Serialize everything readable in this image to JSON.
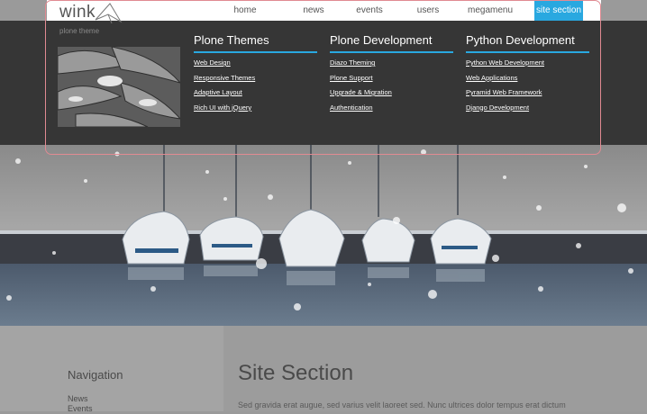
{
  "header": {
    "logo_text": "wink",
    "logo_subtitle": "plone theme",
    "nav": [
      {
        "label": "home"
      },
      {
        "label": "news"
      },
      {
        "label": "events"
      },
      {
        "label": "users"
      },
      {
        "label": "megamenu"
      },
      {
        "label": "site section",
        "active": true
      }
    ]
  },
  "megamenu": {
    "columns": [
      {
        "title": "Plone Themes",
        "links": [
          "Web Design",
          "Responsive Themes",
          "Adaptive Layout",
          "Rich UI with jQuery"
        ]
      },
      {
        "title": "Plone Development",
        "links": [
          "Diazo Theming",
          "Plone Support",
          "Upgrade & Migration",
          "Authentication"
        ]
      },
      {
        "title": "Python Development",
        "links": [
          "Python Web Development",
          "Web Applications",
          "Pyramid Web Framework",
          "Django Development"
        ]
      }
    ]
  },
  "sidebar": {
    "heading": "Navigation",
    "items": [
      "News",
      "Events"
    ]
  },
  "main": {
    "title": "Site Section",
    "body": "Sed gravida erat augue, sed varius velit laoreet sed. Nunc ultrices dolor tempus erat dictum"
  },
  "colors": {
    "accent": "#29a8e0",
    "menu_background": "#303030",
    "frame_border": "#e08a92"
  }
}
